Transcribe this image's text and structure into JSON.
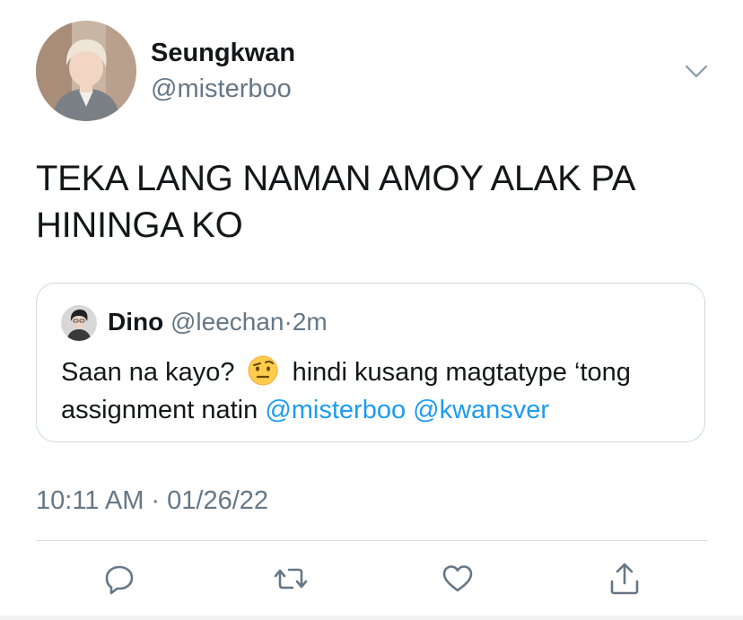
{
  "author": {
    "display_name": "Seungkwan",
    "handle": "@misterboo"
  },
  "tweet": {
    "text": "TEKA LANG NAMAN AMOY ALAK PA HININGA KO",
    "timestamp": "10:11 AM · 01/26/22"
  },
  "quoted_tweet": {
    "display_name": "Dino",
    "handle": "@leechan",
    "separator": "·",
    "time": "2m",
    "text_before_emoji": "Saan na kayo?",
    "emoji": "raised-eyebrow-emoji",
    "text_after_emoji": "hindi kusang magtatype ‘tong assignment natin",
    "mentions": [
      "@misterboo",
      "@kwansver"
    ]
  },
  "actions": {
    "icons": [
      "reply-icon",
      "retweet-icon",
      "like-icon",
      "share-icon"
    ]
  },
  "colors": {
    "link": "#1d9bf0",
    "secondary_text": "#657786",
    "border": "#cfd9de",
    "action_icon": "#657786"
  }
}
